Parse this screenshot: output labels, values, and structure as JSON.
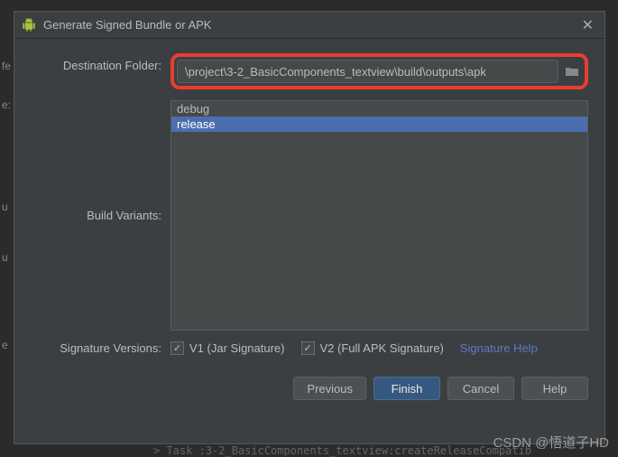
{
  "window": {
    "title": "Generate Signed Bundle or APK"
  },
  "labels": {
    "destination": "Destination Folder:",
    "variants": "Build Variants:",
    "signature": "Signature Versions:"
  },
  "destination": {
    "path": "\\project\\3-2_BasicComponents_textview\\build\\outputs\\apk"
  },
  "variants": {
    "items": [
      "debug",
      "release"
    ],
    "selected_index": 1
  },
  "signature_versions": {
    "v1": {
      "checked": true,
      "label": "V1 (Jar Signature)"
    },
    "v2": {
      "checked": true,
      "label": "V2 (Full APK Signature)"
    },
    "help_link": "Signature Help"
  },
  "buttons": {
    "previous": "Previous",
    "finish": "Finish",
    "cancel": "Cancel",
    "help": "Help"
  },
  "watermark": "CSDN @悟道子HD",
  "background_task": "> Task :3-2_BasicComponents_textview:createReleaseCompatib",
  "side_chars": {
    "c1": "fe",
    "c2": "e:",
    "c3": "u",
    "c4": "u",
    "c5": "e"
  }
}
